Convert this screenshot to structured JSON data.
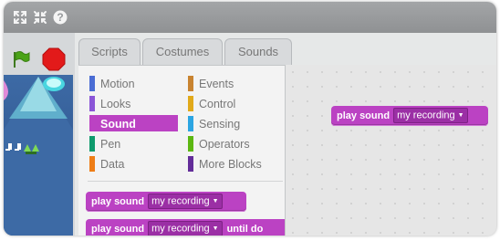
{
  "toolbar": {
    "icons": [
      "fullscreen-expand-icon",
      "fullscreen-collapse-icon",
      "help-icon"
    ],
    "help_glyph": "?"
  },
  "stage_controls": {
    "flag_icon": "green-flag-icon",
    "stop_icon": "stop-icon"
  },
  "tabs": [
    {
      "label": "Scripts",
      "active": true
    },
    {
      "label": "Costumes",
      "active": false
    },
    {
      "label": "Sounds",
      "active": false
    }
  ],
  "categories": [
    {
      "label": "Motion",
      "color": "#4a6cd4"
    },
    {
      "label": "Events",
      "color": "#c88330"
    },
    {
      "label": "Looks",
      "color": "#8a55d7"
    },
    {
      "label": "Control",
      "color": "#e1a91a"
    },
    {
      "label": "Sound",
      "color": "#bb42c3",
      "selected": true
    },
    {
      "label": "Sensing",
      "color": "#2ca5e2"
    },
    {
      "label": "Pen",
      "color": "#0e9a6c"
    },
    {
      "label": "Operators",
      "color": "#5cb712"
    },
    {
      "label": "Data",
      "color": "#ee7d16"
    },
    {
      "label": "More Blocks",
      "color": "#632d99"
    }
  ],
  "palette_blocks": [
    {
      "text": "play sound",
      "dropdown": "my recording",
      "suffix": ""
    },
    {
      "text": "play sound",
      "dropdown": "my recording",
      "suffix": "until do"
    }
  ],
  "script_block": {
    "text": "play sound",
    "dropdown": "my recording"
  }
}
